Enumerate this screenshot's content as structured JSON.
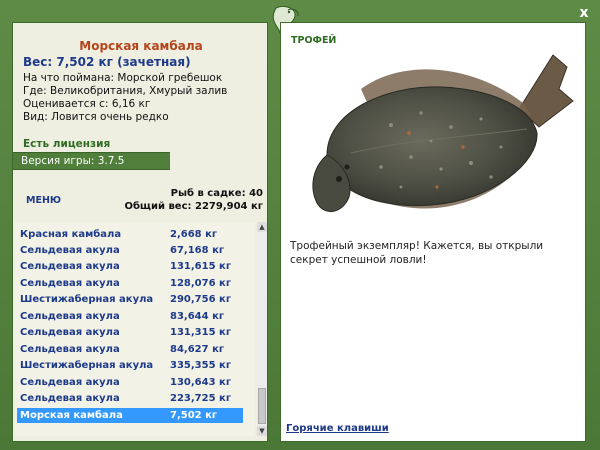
{
  "close_label": "x",
  "fish": {
    "name": "Морская камбала",
    "weight": "Вес: 7,502 кг (зачетная)",
    "info": [
      "На что поймана: Морской гребешок",
      "Где: Великобритания, Хмурый залив",
      "Оценивается с: 6,16 кг",
      "Вид: Ловится очень редко"
    ]
  },
  "license": "Есть лицензия",
  "version": "Версия игры: 3.7.5",
  "menu_label": "МЕНЮ",
  "keepnet": {
    "count": "Рыб в садке: 40",
    "total": "Общий вес: 2279,904 кг"
  },
  "catch_list": [
    {
      "name": "Красная камбала",
      "weight": "2,668 кг"
    },
    {
      "name": "Сельдевая акула",
      "weight": "67,168 кг"
    },
    {
      "name": "Сельдевая акула",
      "weight": "131,615 кг"
    },
    {
      "name": "Сельдевая акула",
      "weight": "128,076 кг"
    },
    {
      "name": "Шестижаберная акула",
      "weight": "290,756 кг"
    },
    {
      "name": "Сельдевая акула",
      "weight": "83,644 кг"
    },
    {
      "name": "Сельдевая акула",
      "weight": "131,315 кг"
    },
    {
      "name": "Сельдевая акула",
      "weight": "84,627 кг"
    },
    {
      "name": "Шестижаберная акула",
      "weight": "335,355 кг"
    },
    {
      "name": "Сельдевая акула",
      "weight": "130,643 кг"
    },
    {
      "name": "Сельдевая акула",
      "weight": "223,725 кг"
    },
    {
      "name": "Морская камбала",
      "weight": "7,502 кг"
    }
  ],
  "trophy": {
    "label": "ТРОФЕЙ",
    "text": "Трофейный экземпляр! Кажется, вы открыли секрет успешной ловли!"
  },
  "hotkeys_label": "Горячие клавиши",
  "colors": {
    "frame": "#4d7a3a",
    "panel": "#efefe1",
    "fish_name": "#b5451b",
    "link": "#1e3a8a",
    "selected": "#3399ff"
  }
}
